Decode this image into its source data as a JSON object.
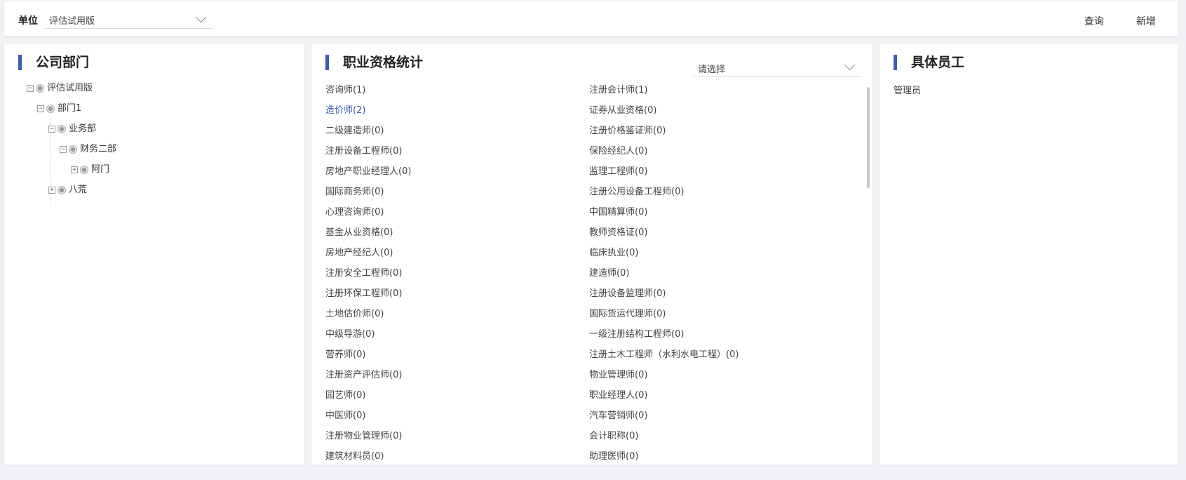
{
  "topbar": {
    "unit_label": "单位",
    "unit_value": "评估试用版",
    "query_label": "查询",
    "add_label": "新增"
  },
  "departments": {
    "title": "公司部门",
    "tree": [
      "评估试用版",
      "部门1",
      "业务部",
      "财务二部",
      "阿门",
      "八荒"
    ]
  },
  "qualifications": {
    "title": "职业资格统计",
    "select_placeholder": "请选择",
    "col1": [
      "咨询师(1)",
      "造价师(2)",
      "二级建造师(0)",
      "注册设备工程师(0)",
      "房地产职业经理人(0)",
      "国际商务师(0)",
      "心理咨询师(0)",
      "基金从业资格(0)",
      "房地产经纪人(0)",
      "注册安全工程师(0)",
      "注册环保工程师(0)",
      "土地估价师(0)",
      "中级导游(0)",
      "营养师(0)",
      "注册资产评估师(0)",
      "园艺师(0)",
      "中医师(0)",
      "注册物业管理师(0)",
      "建筑材料员(0)"
    ],
    "col2": [
      "注册会计师(1)",
      "证券从业资格(0)",
      "注册价格鉴证师(0)",
      "保险经纪人(0)",
      "监理工程师(0)",
      "注册公用设备工程师(0)",
      "中国精算师(0)",
      "教师资格证(0)",
      "临床执业(0)",
      "建造师(0)",
      "注册设备监理师(0)",
      "国际货运代理师(0)",
      "一级注册结构工程师(0)",
      "注册土木工程师（水利水电工程）(0)",
      "物业管理师(0)",
      "职业经理人(0)",
      "汽车营销师(0)",
      "会计职称(0)",
      "助理医师(0)"
    ],
    "active_item": "造价师(2)"
  },
  "employees": {
    "title": "具体员工",
    "items": [
      "管理员"
    ]
  },
  "colors": {
    "accent": "#3a5dad"
  }
}
